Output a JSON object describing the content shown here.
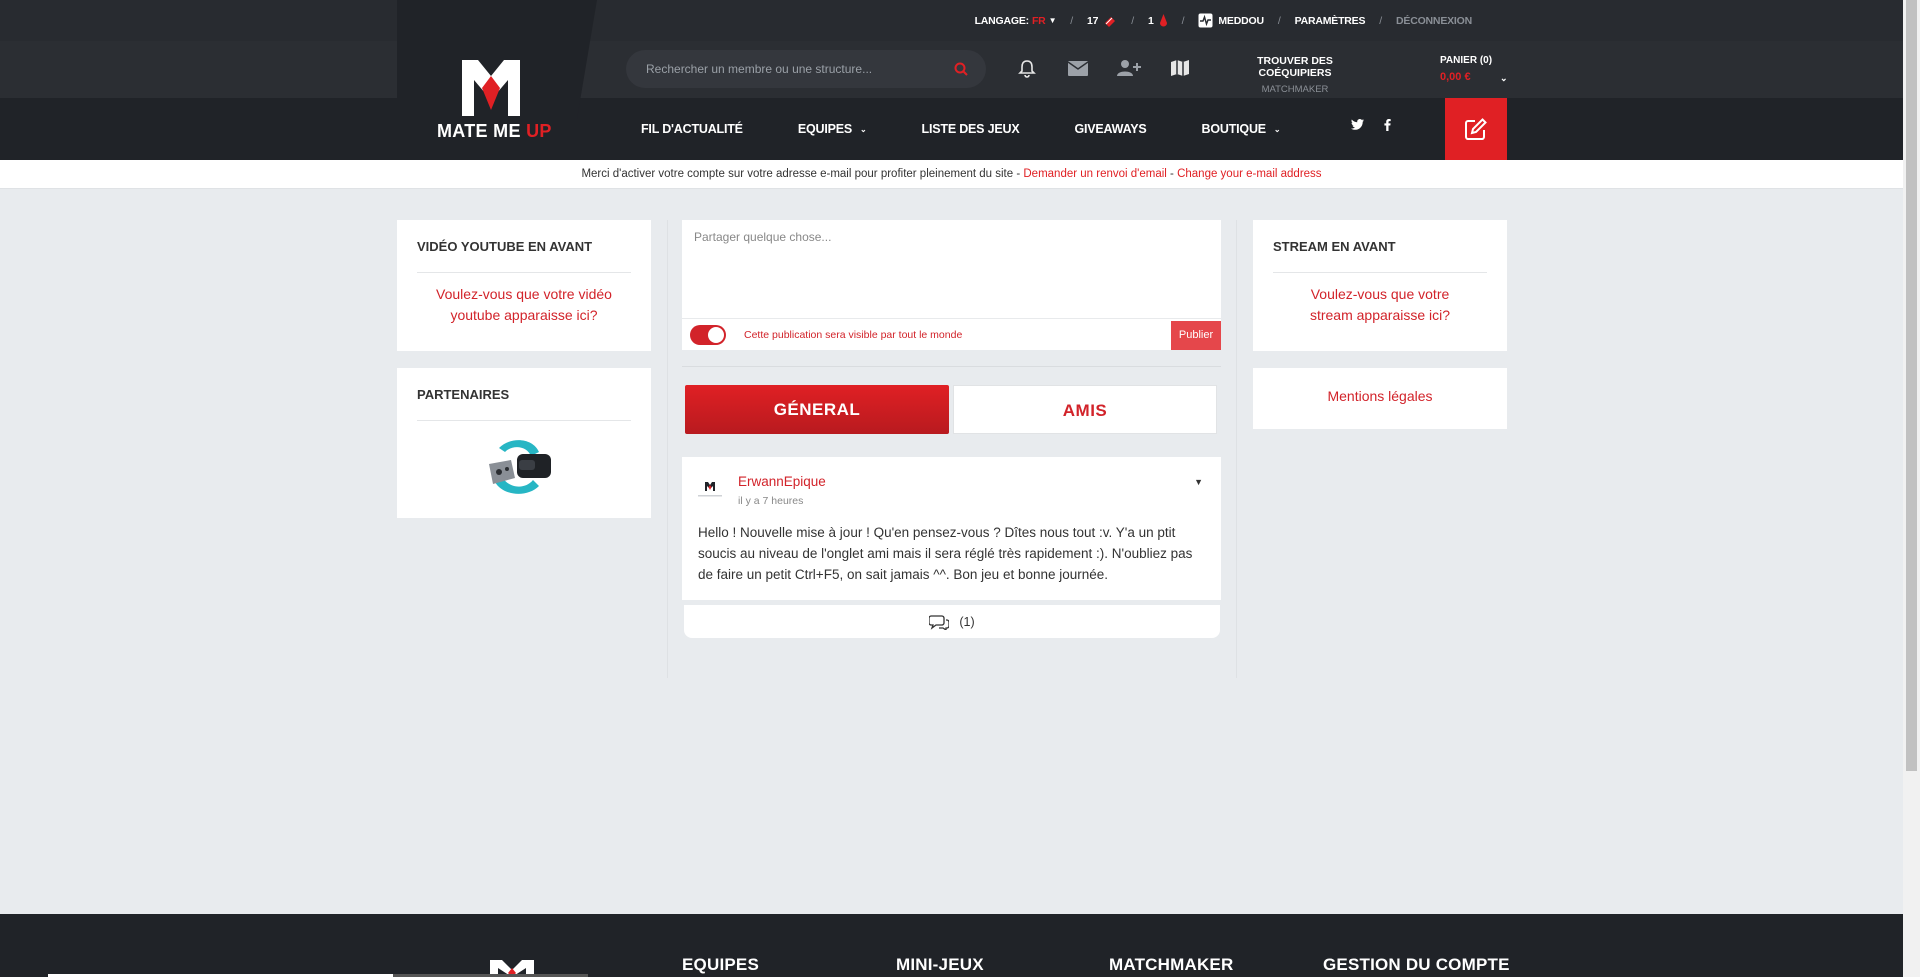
{
  "topbar": {
    "language_label": "LANGAGE:",
    "language_value": "FR",
    "coins": "17",
    "drops": "1",
    "username": "MEDDOU",
    "settings": "PARAMÈTRES",
    "logout": "DÉCONNEXION",
    "separator": "/"
  },
  "header": {
    "logo_text_main": "MATE ME ",
    "logo_text_accent": "UP",
    "search_placeholder": "Rechercher un membre ou une structure...",
    "find_title": "TROUVER DES COÉQUIPIERS",
    "find_sub": "MATCHMAKER",
    "cart_label": "PANIER (0)",
    "cart_price": "0,00 €"
  },
  "nav": {
    "items": [
      {
        "label": "FIL D'ACTUALITÉ",
        "dropdown": false
      },
      {
        "label": "EQUIPES",
        "dropdown": true
      },
      {
        "label": "LISTE DES JEUX",
        "dropdown": false
      },
      {
        "label": "GIVEAWAYS",
        "dropdown": false
      },
      {
        "label": "BOUTIQUE",
        "dropdown": true
      }
    ]
  },
  "notice": {
    "text": "Merci d'activer votre compte sur votre adresse e-mail pour profiter pleinement du site - ",
    "link1": "Demander un renvoi d'email",
    "between": " - ",
    "link2": "Change your e-mail address"
  },
  "left": {
    "youtube_title": "VIDÉO YOUTUBE EN AVANT",
    "youtube_cta": "Voulez-vous que votre vidéo youtube apparaisse ici?",
    "partners_title": "PARTENAIRES"
  },
  "right": {
    "stream_title": "STREAM EN AVANT",
    "stream_cta": "Voulez-vous que votre stream apparaisse ici?",
    "legal": "Mentions légales"
  },
  "composer": {
    "placeholder": "Partager quelque chose...",
    "visibility": "Cette publication sera visible par tout le monde",
    "publish": "Publier"
  },
  "tabs": {
    "general": "GÉNERAL",
    "friends": "AMIS"
  },
  "post": {
    "author": "ErwannEpique",
    "time": "il y a 7 heures",
    "text": "Hello ! Nouvelle mise à jour ! Qu'en pensez-vous ? Dîtes nous tout :v. Y'a un ptit soucis au niveau de l'onglet ami mais il sera réglé très rapidement :). N'oubliez pas de faire un petit Ctrl+F5, on sait jamais ^^. Bon jeu et bonne journée.",
    "comments": "(1)"
  },
  "footer": {
    "columns": [
      "EQUIPES",
      "MINI-JEUX",
      "MATCHMAKER",
      "GESTION DU COMPTE"
    ]
  },
  "colors": {
    "accent": "#e02024",
    "header_bg": "#202328",
    "page_bg": "#e8ebee"
  }
}
